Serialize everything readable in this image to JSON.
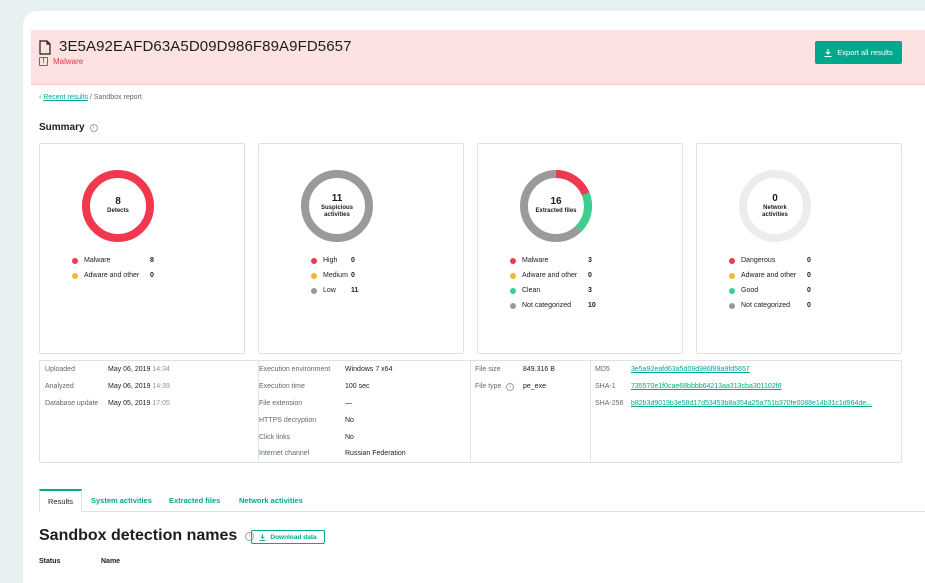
{
  "header": {
    "hash": "3E5A92EAFD63A5D09D986F89A9FD5657",
    "verdict": "Malware",
    "export_label": "Export all results"
  },
  "breadcrumb": {
    "back": "‹",
    "link": "Recent results",
    "separator": "/",
    "current": "Sandbox report"
  },
  "summary": {
    "title": "Summary",
    "cards": [
      {
        "number": "8",
        "label": "Detects",
        "legend": [
          {
            "name": "Malware",
            "value": "8",
            "color": "#f0384f"
          },
          {
            "name": "Adware and other",
            "value": "0",
            "color": "#f6b731"
          }
        ]
      },
      {
        "number": "11",
        "label": "Suspicious activities",
        "legend": [
          {
            "name": "High",
            "value": "0",
            "color": "#f0384f"
          },
          {
            "name": "Medium",
            "value": "0",
            "color": "#f6b731"
          },
          {
            "name": "Low",
            "value": "11",
            "color": "#9a9a9a"
          }
        ]
      },
      {
        "number": "16",
        "label": "Extracted files",
        "legend": [
          {
            "name": "Malware",
            "value": "3",
            "color": "#f0384f"
          },
          {
            "name": "Adware and other",
            "value": "0",
            "color": "#f6b731"
          },
          {
            "name": "Clean",
            "value": "3",
            "color": "#3ccf8e"
          },
          {
            "name": "Not categorized",
            "value": "10",
            "color": "#9a9a9a"
          }
        ]
      },
      {
        "number": "0",
        "label": "Network activities",
        "legend": [
          {
            "name": "Dangerous",
            "value": "0",
            "color": "#f0384f"
          },
          {
            "name": "Adware and other",
            "value": "0",
            "color": "#f6b731"
          },
          {
            "name": "Good",
            "value": "0",
            "color": "#3ccf8e"
          },
          {
            "name": "Not categorized",
            "value": "0",
            "color": "#9a9a9a"
          }
        ]
      }
    ]
  },
  "details": {
    "dates": [
      {
        "key": "Uploaded",
        "date": "May 06, 2019",
        "time": "14:34"
      },
      {
        "key": "Analyzed",
        "date": "May 06, 2019",
        "time": "14:39"
      },
      {
        "key": "Database update",
        "date": "May 05, 2019",
        "time": "17:05"
      }
    ],
    "execution": [
      {
        "key": "Execution environment",
        "value": "Windows 7 x64"
      },
      {
        "key": "Execution time",
        "value": "100 sec"
      },
      {
        "key": "File extension",
        "value": "—"
      },
      {
        "key": "HTTPS decryption",
        "value": "No"
      },
      {
        "key": "Click links",
        "value": "No"
      },
      {
        "key": "Internet channel",
        "value": "Russian Federation"
      }
    ],
    "file": [
      {
        "key": "File size",
        "value": "849.316 B"
      },
      {
        "key": "File type",
        "value": "pe_exe"
      }
    ],
    "hashes": [
      {
        "key": "MD5",
        "value": "3e5a92eafd63a5d09d986f89a9fd5657"
      },
      {
        "key": "SHA-1",
        "value": "735570e1f0cae68bbbb64213aa313cba301102f6"
      },
      {
        "key": "SHA-256",
        "value": "b82b3d9019b3e58d17d53453b8a354a25a751b370fe0088e14b31c1d964de..."
      }
    ]
  },
  "tabs": [
    "Results",
    "System activities",
    "Extracted files",
    "Network activities"
  ],
  "section": {
    "title": "Sandbox detection names",
    "download_label": "Download data",
    "columns": [
      "Status",
      "Name"
    ]
  }
}
